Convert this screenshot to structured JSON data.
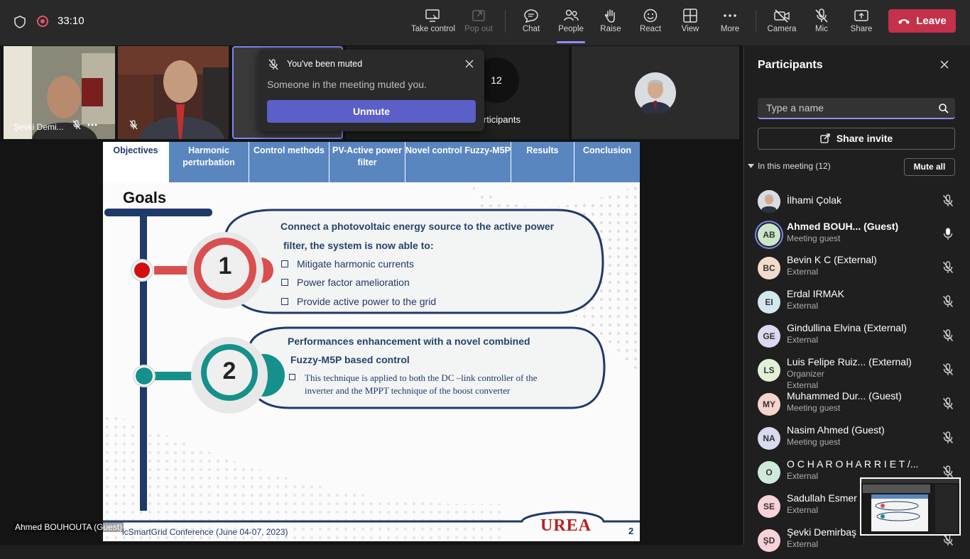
{
  "timer": "33:10",
  "toolbar": [
    {
      "label": "Take control",
      "icon": "take-control-icon",
      "x": 0
    },
    {
      "label": "Pop out",
      "icon": "pop-out-icon",
      "x": 0
    },
    {
      "label": "Chat",
      "icon": "chat-icon"
    },
    {
      "label": "People",
      "icon": "people-icon"
    },
    {
      "label": "Raise",
      "icon": "raise-hand-icon"
    },
    {
      "label": "React",
      "icon": "react-icon"
    },
    {
      "label": "View",
      "icon": "view-icon"
    },
    {
      "label": "More",
      "icon": "more-icon"
    },
    {
      "label": "Camera",
      "icon": "camera-off-icon"
    },
    {
      "label": "Mic",
      "icon": "mic-off-icon"
    },
    {
      "label": "Share",
      "icon": "share-icon"
    }
  ],
  "leave_label": "Leave",
  "tiles": {
    "tile1_name": "Şevki Demi...",
    "overflow_count": "12",
    "overflow_label": "Participants"
  },
  "toast": {
    "title": "You've been muted",
    "message": "Someone in the meeting muted you.",
    "button": "Unmute"
  },
  "slide": {
    "tabs": [
      "Objectives",
      "Harmonic perturbation",
      "Control methods",
      "PV-Active power filter",
      "Novel control Fuzzy-M5P",
      "Results",
      "Conclusion"
    ],
    "heading": "Goals",
    "goal1_num": "1",
    "goal1_line1": "Connect a photovoltaic energy source to the active power",
    "goal1_line2": "filter, the system is now able to:",
    "goal1_bullets": [
      "Mitigate harmonic currents",
      "Power factor amelioration",
      "Provide active power to the grid"
    ],
    "goal2_num": "2",
    "goal2_line1": "Performances enhancement with a novel combined",
    "goal2_line2": "Fuzzy-M5P based control",
    "goal2_detail1": "This technique is applied to both the DC –link controller of the",
    "goal2_detail2": "inverter and the MPPT technique of the boost converter",
    "footer": "icSmartGrid Conference (June 04-07, 2023)",
    "logo": "UREA",
    "page": "2"
  },
  "presenter_name": "Ahmed BOUHOUTA (Guest)",
  "panel": {
    "title": "Participants",
    "search_placeholder": "Type a name",
    "share_invite": "Share invite",
    "in_meeting": "In this meeting (12)",
    "mute_all": "Mute all",
    "people": [
      {
        "name": "İlhami Çolak",
        "role": "",
        "initials": "",
        "color": "#cfd4da",
        "muted": true
      },
      {
        "name": "Ahmed BOUH...   (Guest)",
        "role": "Meeting guest",
        "initials": "AB",
        "color": "#c9e6c8",
        "muted": false
      },
      {
        "name": "Bevin K C (External)",
        "role": "External",
        "initials": "BC",
        "color": "#f1dccb",
        "muted": true
      },
      {
        "name": "Erdal IRMAK",
        "role": "External",
        "initials": "EI",
        "color": "#d3e7ef",
        "muted": true
      },
      {
        "name": "Gindullina Elvina (External)",
        "role": "External",
        "initials": "GE",
        "color": "#dcd8ee",
        "muted": true
      },
      {
        "name": "Luis Felipe Ruiz...  (External)",
        "role": "Organizer",
        "role2": "External",
        "initials": "LS",
        "color": "#e4f0d6",
        "muted": true
      },
      {
        "name": "Muhammed Dur... (Guest)",
        "role": "Meeting guest",
        "initials": "MY",
        "color": "#f6d3cd",
        "muted": true
      },
      {
        "name": "Nasim Ahmed (Guest)",
        "role": "Meeting guest",
        "initials": "NA",
        "color": "#d8dbef",
        "muted": true
      },
      {
        "name": "O C H A R O H A R R I E T /...",
        "role": "External",
        "initials": "O",
        "color": "#cfeadb",
        "muted": true
      },
      {
        "name": "Sadullah Esmer",
        "role": "External",
        "initials": "SE",
        "color": "#f7d2d8",
        "muted": true
      },
      {
        "name": "Şevki Demirbaş",
        "role": "External",
        "initials": "ŞD",
        "color": "#f7d2d8",
        "muted": true
      }
    ]
  }
}
